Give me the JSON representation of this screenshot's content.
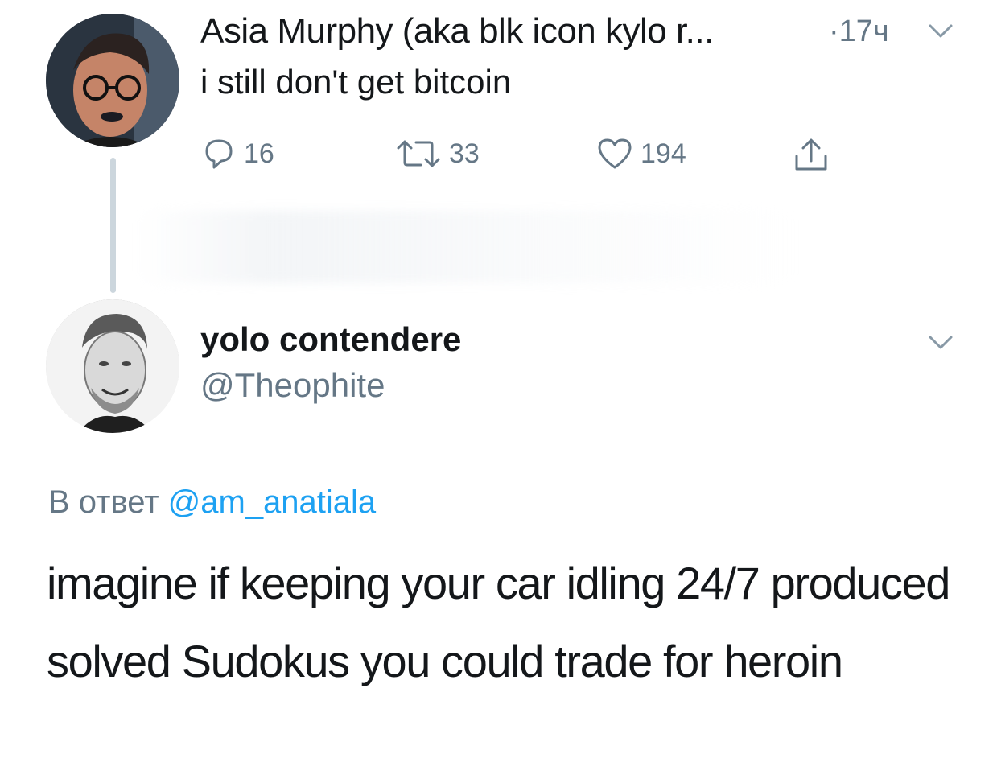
{
  "parent_tweet": {
    "display_name": "Asia Murphy (aka blk icon kylo r...",
    "timestamp": "·17ч",
    "text": "i still don't get bitcoin",
    "avatar_icon": "profile-photo",
    "caret_icon": "chevron-down-icon",
    "actions": {
      "reply": {
        "icon": "reply-icon",
        "count": "16"
      },
      "retweet": {
        "icon": "retweet-icon",
        "count": "33"
      },
      "like": {
        "icon": "heart-icon",
        "count": "194"
      },
      "share": {
        "icon": "share-icon"
      }
    }
  },
  "reply_tweet": {
    "display_name": "yolo contendere",
    "handle": "@Theophite",
    "avatar_icon": "profile-photo",
    "caret_icon": "chevron-down-icon",
    "reply_to_prefix": "В ответ ",
    "reply_to_mention": "@am_anatiala",
    "text": "imagine if keeping your car idling 24/7 produced solved Sudokus you could trade for heroin"
  },
  "colors": {
    "text_primary": "#14171a",
    "text_secondary": "#657786",
    "link": "#1da1f2",
    "thread_line": "#ccd6dd"
  }
}
